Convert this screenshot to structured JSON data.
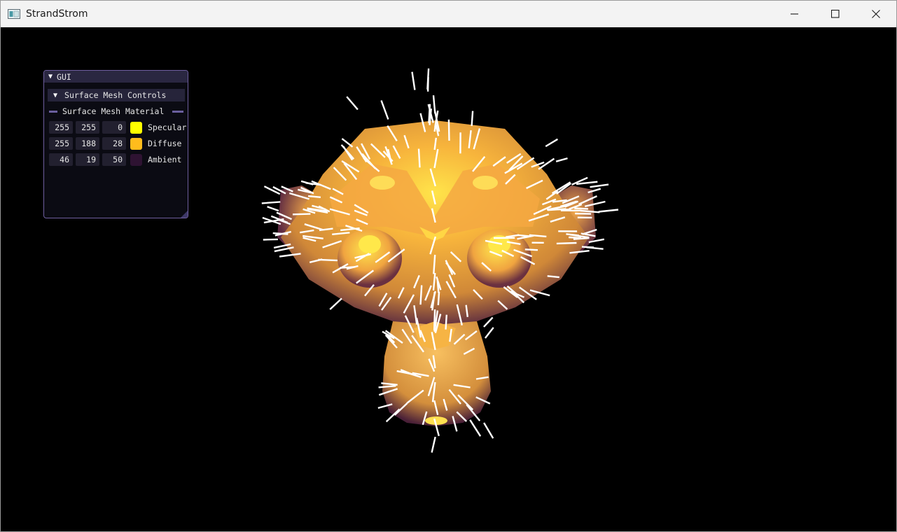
{
  "window": {
    "title": "StrandStrom",
    "icon": "app-window-icon",
    "controls": {
      "minimize": "minimize-icon",
      "maximize": "maximize-icon",
      "close": "close-icon"
    }
  },
  "gui": {
    "title": "GUI",
    "section": {
      "title": "Surface Mesh Controls",
      "expanded": true
    },
    "separator_label": "Surface Mesh Material",
    "materials": [
      {
        "r": "255",
        "g": "255",
        "b": "0",
        "label": "Specular",
        "color": "#ffff00"
      },
      {
        "r": "255",
        "g": "188",
        "b": "28",
        "label": "Diffuse",
        "color": "#ffbc1c"
      },
      {
        "r": "46",
        "g": "19",
        "b": "50",
        "label": "Ambient",
        "color": "#2e1332"
      }
    ]
  },
  "viewport": {
    "background": "#000000",
    "mesh": "suzanne-monkey-head",
    "normals_color": "#ffffff"
  }
}
